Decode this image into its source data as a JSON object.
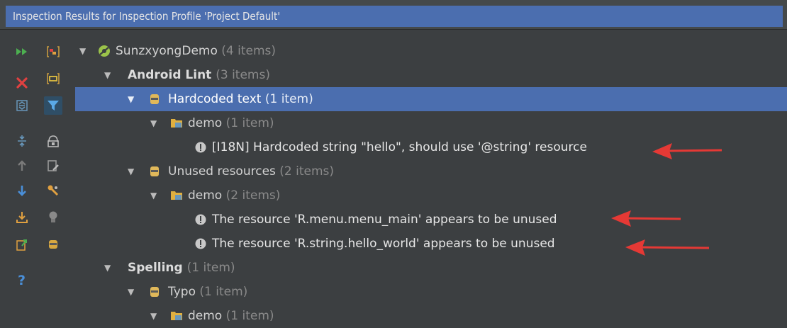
{
  "window": {
    "title": "Inspection Results for Inspection Profile 'Project Default'"
  },
  "toolbar": {
    "left": [
      {
        "icon": "run-icon",
        "color": "#4caf50"
      },
      {
        "icon": "close-icon",
        "color": "#e04141"
      },
      {
        "icon": "expand-all-icon",
        "color": "#6897bb"
      },
      {
        "icon": "collapse-all-icon",
        "color": "#6897bb"
      },
      {
        "icon": "up-arrow-icon",
        "color": "#7a7a7a"
      },
      {
        "icon": "down-arrow-icon",
        "color": "#4a8fd8"
      },
      {
        "icon": "export-icon",
        "color": "#e0a040"
      },
      {
        "icon": "export-html-icon",
        "color": "#4caf50"
      },
      {
        "icon": "help-icon",
        "color": "#4a8fd8"
      }
    ],
    "right": [
      {
        "icon": "group-by-severity-icon"
      },
      {
        "icon": "group-by-directory-icon"
      },
      {
        "icon": "filter-icon",
        "active": true
      },
      {
        "icon": "offline-view-icon"
      },
      {
        "icon": "edit-settings-icon"
      },
      {
        "icon": "settings-wrench-icon"
      },
      {
        "icon": "quickfix-bulb-icon"
      },
      {
        "icon": "suppress-icon"
      }
    ]
  },
  "tree": {
    "root": {
      "name": "SunzxyongDemo",
      "count": "(4 items)"
    },
    "android_lint": {
      "name": "Android Lint",
      "count": "(3 items)"
    },
    "hardcoded": {
      "name": "Hardcoded text",
      "count": "(1 item)"
    },
    "demo1": {
      "name": "demo",
      "count": "(1 item)"
    },
    "msg_hardcoded": "[I18N] Hardcoded string \"hello\", should use '@string' resource",
    "unused": {
      "name": "Unused resources",
      "count": "(2 items)"
    },
    "demo2": {
      "name": "demo",
      "count": "(2 items)"
    },
    "msg_unused1": "The resource 'R.menu.menu_main' appears to be unused",
    "msg_unused2": "The resource 'R.string.hello_world' appears to be unused",
    "spelling": {
      "name": "Spelling",
      "count": "(1 item)"
    },
    "typo": {
      "name": "Typo",
      "count": "(1 item)"
    },
    "demo3": {
      "name": "demo",
      "count": "(1 item)"
    }
  },
  "colors": {
    "background": "#3c3f41",
    "selection": "#4b6eaf",
    "annotation_arrow": "#e53935"
  }
}
